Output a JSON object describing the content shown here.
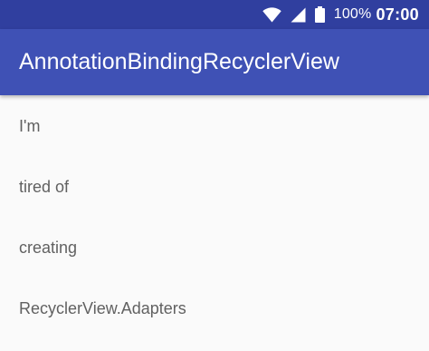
{
  "status_bar": {
    "battery_percent": "100%",
    "time": "07:00",
    "icons": [
      "wifi-icon",
      "cell-signal-icon",
      "battery-icon"
    ]
  },
  "app_bar": {
    "title": "AnnotationBindingRecyclerView"
  },
  "list": {
    "items": [
      {
        "text": "I'm"
      },
      {
        "text": "tired of"
      },
      {
        "text": "creating"
      },
      {
        "text": "RecyclerView.Adapters"
      }
    ]
  },
  "colors": {
    "status_bar": "#303f9f",
    "app_bar": "#3f51b5",
    "background": "#fafafa",
    "item_text": "#616161"
  }
}
